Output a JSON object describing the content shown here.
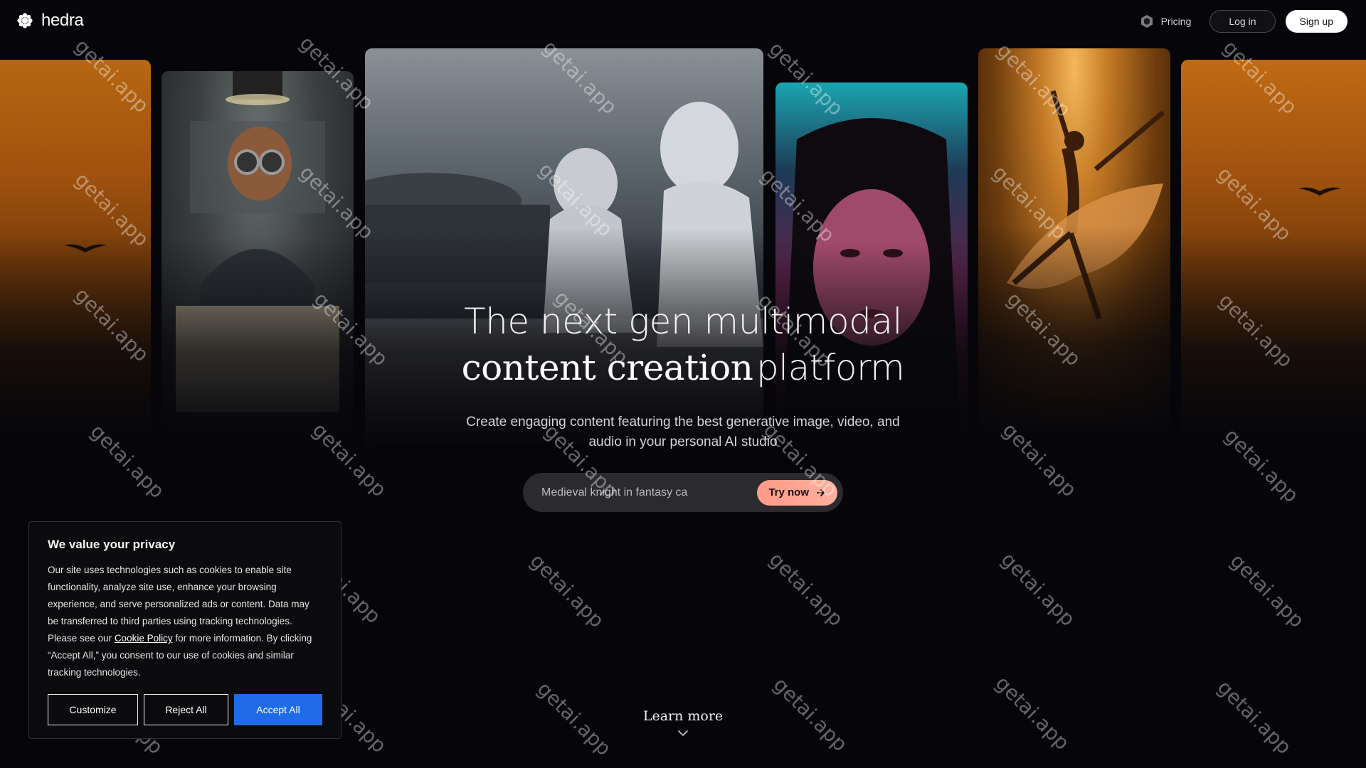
{
  "brand": {
    "name": "hedra"
  },
  "nav": {
    "pricing_label": "Pricing",
    "login_label": "Log in",
    "signup_label": "Sign up"
  },
  "hero": {
    "line1": "The next gen multimodal",
    "line2_serif": "content creation",
    "line2_sans": "platform",
    "subtitle_line1": "Create engaging content featuring the best generative image, video, and",
    "subtitle_line2": "audio in your personal AI studio"
  },
  "prompt": {
    "value": "Medieval knight in fantasy ca",
    "try_label": "Try now"
  },
  "learn_more": {
    "label": "Learn more"
  },
  "cookie": {
    "title": "We value your privacy",
    "body_before": "Our site uses technologies such as cookies to enable site functionality, analyze site use, enhance your browsing experience, and serve personalized ads or content. Data may be transferred to third parties using tracking technologies. Please see our ",
    "link_text": "Cookie Policy",
    "body_after": " for more information. By clicking “Accept All,” you consent to our use of cookies and similar tracking technologies.",
    "customize_label": "Customize",
    "reject_label": "Reject All",
    "accept_label": "Accept All"
  },
  "watermark": {
    "text": "getai.app"
  },
  "colors": {
    "background": "#06060a",
    "try_button": "#ff9a86",
    "accept_button": "#1f6be8"
  },
  "icons": {
    "logo": "hedra-logo-icon",
    "pricing": "hexagon-icon",
    "try": "arrow-right-icon",
    "learn_more": "chevron-down-icon"
  }
}
